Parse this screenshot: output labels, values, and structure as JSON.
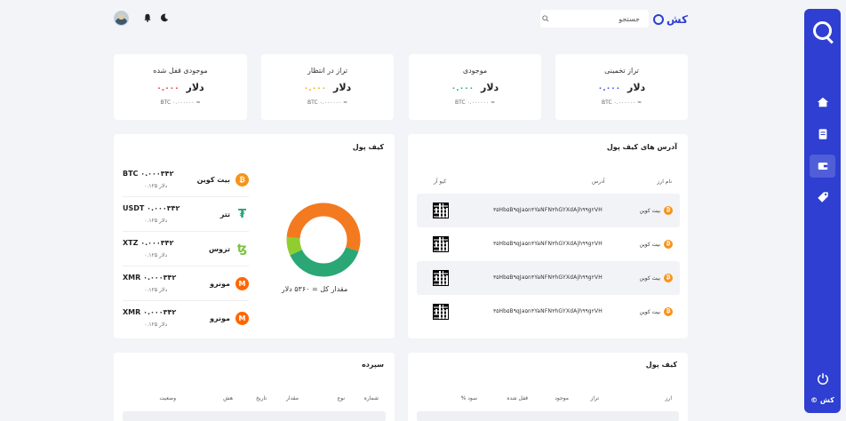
{
  "sidebar": {
    "footer": "© کش",
    "items": [
      "home",
      "document",
      "wallet",
      "tag"
    ],
    "active": "wallet"
  },
  "topbar": {
    "brand": "کش",
    "search_placeholder": "جستجو"
  },
  "stats": [
    {
      "title": "تراز تخمینی",
      "value": "٠.٠٠٠",
      "unit": "دلار",
      "sub": "BTC ٠.٠٠٠٠٠٠ ≈",
      "dot_color": "#3f51d9"
    },
    {
      "title": "موجودی",
      "value": "٠.٠٠٠",
      "unit": "دلار",
      "sub": "BTC ٠.٠٠٠٠٠٠ ≈",
      "dot_color": "#2aa775"
    },
    {
      "title": "تراز در انتظار",
      "value": "٠.٠٠٠",
      "unit": "دلار",
      "sub": "BTC ٠.٠٠٠٠٠٠ ≈",
      "dot_color": "#f2a91b"
    },
    {
      "title": "موجودی قفل شده",
      "value": "٠.٠٠٠",
      "unit": "دلار",
      "sub": "BTC ٠.٠٠٠٠٠٠ ≈",
      "dot_color": "#e53b3b"
    }
  ],
  "wallet_card": {
    "title": "کیف پول",
    "total": "مقدار کل = ۵۳۶۰ دلار",
    "rows": [
      {
        "name": "بیت کوین",
        "amount": "BTC ٠.٠٠٠٣۴٢",
        "fiat": "٠.١٢۵ دلار",
        "icon": "bitcoin-icon",
        "color": "#f7931a",
        "glyph": "₿"
      },
      {
        "name": "تتر",
        "amount": "USDT ٠.٠٠٠٣۴٢",
        "fiat": "٠.١٢۵ دلار",
        "icon": "tether-icon",
        "color": "#26a17b",
        "glyph": "₮"
      },
      {
        "name": "تزوس",
        "amount": "XTZ ٠.٠٠٠٣۴٢",
        "fiat": "٠.١٢۵ دلار",
        "icon": "tezos-icon",
        "color": "#7ac142",
        "glyph": "ꜩ"
      },
      {
        "name": "مونرو",
        "amount": "XMR ٠.٠٠٠٣۴٢",
        "fiat": "٠.١٢۵ دلار",
        "icon": "monero-icon",
        "color": "#ff6600",
        "glyph": "M"
      },
      {
        "name": "مونرو",
        "amount": "XMR ٠.٠٠٠٣۴٢",
        "fiat": "٠.١٢۵ دلار",
        "icon": "monero-icon",
        "color": "#ff6600",
        "glyph": "M"
      }
    ],
    "donut": [
      {
        "value": 30,
        "color": "#f47a1f"
      },
      {
        "value": 38,
        "color": "#2aa775"
      },
      {
        "value": 8,
        "color": "#8fce2e"
      },
      {
        "value": 24,
        "color": "#f47a1f"
      }
    ]
  },
  "address_card": {
    "title": "آدرس های کیف پول",
    "headers": {
      "coin": "نام ارز",
      "address": "آدرس",
      "qr": "کیو آر"
    },
    "rows": [
      {
        "coin": "بیت کوین",
        "address": "۳۵Hb۵B۹qJa۵n۴YaNFN۳hGYXdAjh۹۹g۲VH"
      },
      {
        "coin": "بیت کوین",
        "address": "۳۵Hb۵B۹qJa۵n۴YaNFN۳hGYXdAjh۹۹g۲VH"
      },
      {
        "coin": "بیت کوین",
        "address": "۳۵Hb۵B۹qJa۵n۴YaNFN۳hGYXdAjh۹۹g۲VH"
      },
      {
        "coin": "بیت کوین",
        "address": "۳۵Hb۵B۹qJa۵n۴YaNFN۳hGYXdAjh۹۹g۲VH"
      }
    ]
  },
  "deposit_card": {
    "title": "سپرده",
    "headers": [
      "شماره",
      "نوع",
      "مقدار",
      "تاریخ",
      "هش",
      "وضعیت"
    ]
  },
  "wallet_table_card": {
    "title": "کیف پول",
    "headers": [
      "ارز",
      "تراز",
      "موجود",
      "قفل شده",
      "% سود"
    ]
  }
}
